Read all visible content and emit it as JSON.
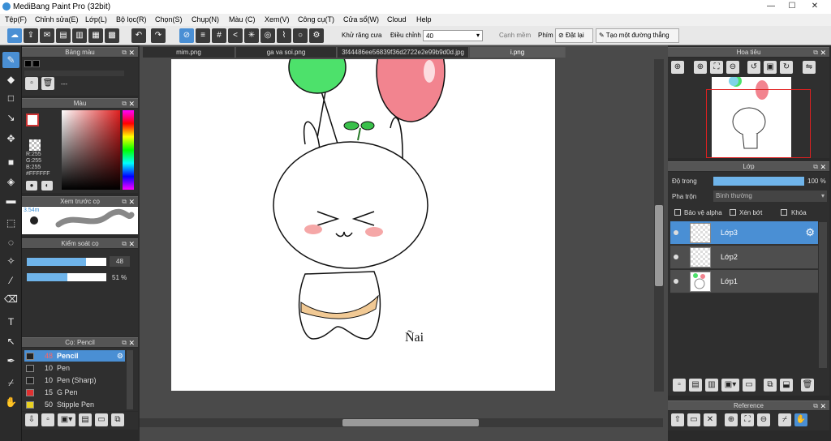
{
  "app": {
    "title": "MediBang Paint Pro (32bit)"
  },
  "menu": [
    "Tệp(F)",
    "Chỉnh sửa(E)",
    "Lớp(L)",
    "Bộ lọc(R)",
    "Chọn(S)",
    "Chụp(N)",
    "Màu (C)",
    "Xem(V)",
    "Công cụ(T)",
    "Cửa sổ(W)",
    "Cloud",
    "Help"
  ],
  "toolbar": {
    "antialias_label": "Khử răng cưa",
    "correction_label": "Điều chỉnh",
    "correction_value": "40",
    "edge_label": "Cạnh mềm",
    "fn_key_label": "Phím",
    "reset_label": "Đặt lại",
    "create_line_label": "Tạo một đường thẳng"
  },
  "tabs": [
    "mim.png",
    "ga va soi.png",
    "3f44486ee56839f36d2722e2e99b9d0d.jpg",
    "i.png"
  ],
  "panels": {
    "palette": "Bảng màu",
    "palette_value": "---",
    "color": "Màu",
    "color_r": "R:255",
    "color_g": "G:255",
    "color_b": "B:255",
    "color_hex": "#FFFFFF",
    "preview": "Xem trước cọ",
    "preview_size": "3.54m",
    "brush_control": "Kiểm soát cọ",
    "size_value": "48",
    "opacity_value": "51 %",
    "brush": "Cọ: Pencil",
    "navigator": "Hoa tiêu",
    "layer": "Lớp",
    "reference": "Reference"
  },
  "brushes": [
    {
      "num": "48",
      "name": "Pencil",
      "color": "#222222",
      "selected": true
    },
    {
      "num": "10",
      "name": "Pen",
      "color": "#222222",
      "selected": false
    },
    {
      "num": "10",
      "name": "Pen (Sharp)",
      "color": "#222222",
      "selected": false
    },
    {
      "num": "15",
      "name": "G Pen",
      "color": "#e03030",
      "selected": false
    },
    {
      "num": "50",
      "name": "Stipple Pen",
      "color": "#e8d020",
      "selected": false
    }
  ],
  "layer_panel": {
    "opacity_label": "Độ trong",
    "opacity_value": "100 %",
    "opacity_fraction": 1.0,
    "blend_label": "Pha trộn",
    "blend_value": "Bình thường",
    "protect_alpha": "Bảo vệ alpha",
    "clipping": "Xén bớt",
    "lock": "Khóa"
  },
  "layers": [
    {
      "name": "Lớp3",
      "selected": true
    },
    {
      "name": "Lớp2",
      "selected": false
    },
    {
      "name": "Lớp1",
      "selected": false
    }
  ],
  "canvas": {
    "signature": "Ñai"
  },
  "colors": {
    "accent": "#4a8fd4",
    "primary_color": "#FFFFFF"
  }
}
